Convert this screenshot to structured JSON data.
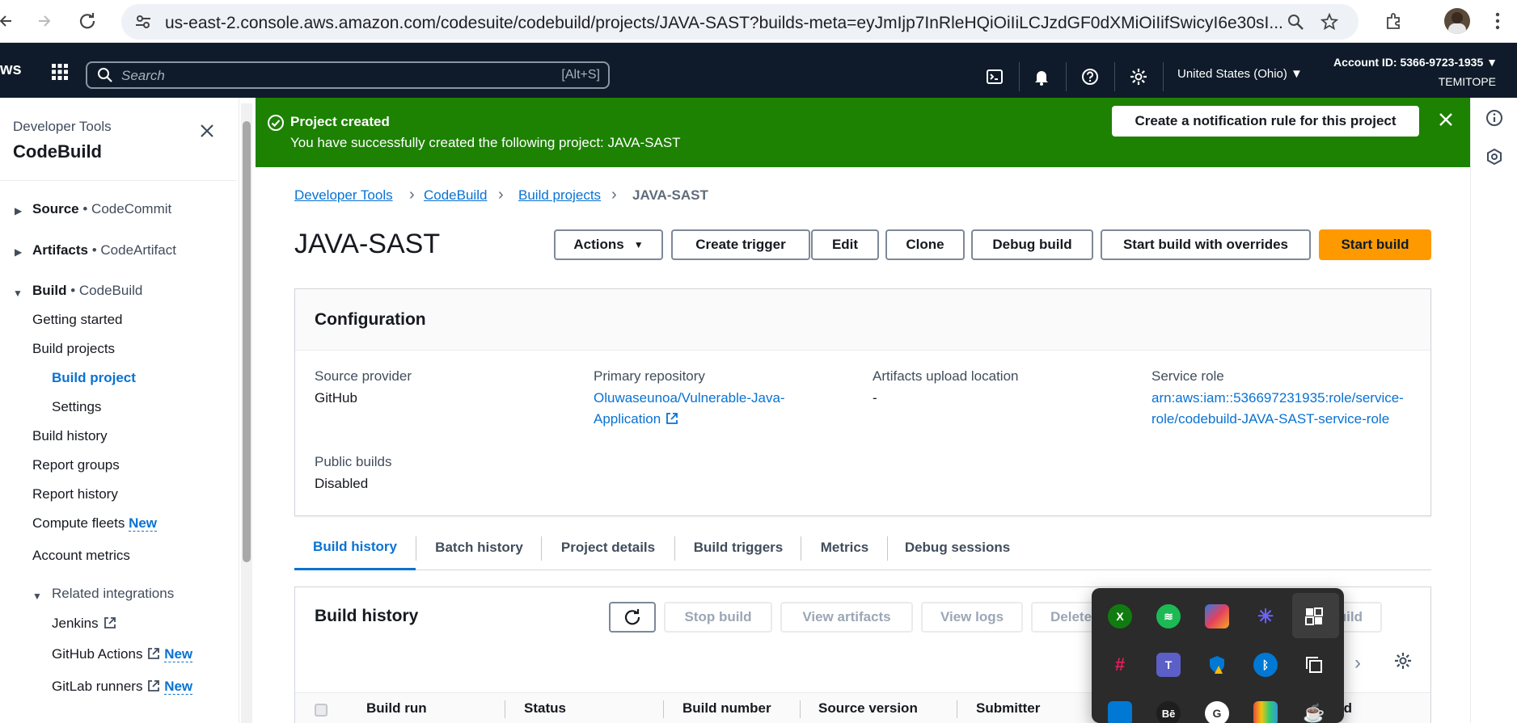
{
  "browser": {
    "url": "us-east-2.console.aws.amazon.com/codesuite/codebuild/projects/JAVA-SAST?builds-meta=eyJmIjp7InRleHQiOiIiLCJzdGF0dXMiOiIifSwicyI6e30sI..."
  },
  "aws_nav": {
    "logo": "ws",
    "search_placeholder": "Search",
    "search_shortcut": "[Alt+S]",
    "region": "United States (Ohio) ▼",
    "account_id": "Account ID: 5366-9723-1935 ▼",
    "user": "TEMITOPE"
  },
  "sidebar": {
    "service": "Developer Tools",
    "title": "CodeBuild",
    "sections": [
      {
        "name": "Source",
        "sub": "• CodeCommit"
      },
      {
        "name": "Artifacts",
        "sub": "• CodeArtifact"
      },
      {
        "name": "Build",
        "sub": "• CodeBuild"
      }
    ],
    "items": {
      "getting_started": "Getting started",
      "build_projects": "Build projects",
      "build_project": "Build project",
      "settings": "Settings",
      "build_history": "Build history",
      "report_groups": "Report groups",
      "report_history": "Report history",
      "compute_fleets": "Compute fleets",
      "account_metrics": "Account metrics",
      "related_integrations": "Related integrations",
      "jenkins": "Jenkins",
      "github_actions": "GitHub Actions",
      "gitlab_runners": "GitLab runners",
      "new_badge": "New"
    }
  },
  "flash": {
    "title": "Project created",
    "message": "You have successfully created the following project: JAVA-SAST",
    "button": "Create a notification rule for this project"
  },
  "breadcrumb": {
    "items": [
      "Developer Tools",
      "CodeBuild",
      "Build projects"
    ],
    "current": "JAVA-SAST"
  },
  "page": {
    "title": "JAVA-SAST",
    "buttons": {
      "actions": "Actions",
      "create_trigger": "Create trigger",
      "edit": "Edit",
      "clone": "Clone",
      "debug_build": "Debug build",
      "start_with_overrides": "Start build with overrides",
      "start_build": "Start build"
    }
  },
  "configuration": {
    "title": "Configuration",
    "source_provider_label": "Source provider",
    "source_provider": "GitHub",
    "primary_repo_label": "Primary repository",
    "primary_repo_line1": "Oluwaseunoa/Vulnerable-Java-",
    "primary_repo_line2": "Application",
    "artifacts_label": "Artifacts upload location",
    "artifacts_value": "-",
    "service_role_label": "Service role",
    "service_role_line1": "arn:aws:iam::536697231935:role/service-",
    "service_role_line2": "role/codebuild-JAVA-SAST-service-role",
    "public_builds_label": "Public builds",
    "public_builds": "Disabled"
  },
  "tabs": [
    "Build history",
    "Batch history",
    "Project details",
    "Build triggers",
    "Metrics",
    "Debug sessions"
  ],
  "build_history": {
    "title": "Build history",
    "buttons": {
      "stop": "Stop build",
      "view_artifacts": "View artifacts",
      "view_logs": "View logs",
      "delete": "Delete",
      "debug": "g build"
    },
    "columns": [
      "Build run",
      "Status",
      "Build number",
      "Source version",
      "Submitter",
      "ated"
    ]
  },
  "tray_popup": {
    "icons": [
      "xbox-icon",
      "spotify-icon",
      "copilot-icon",
      "perplexity-icon",
      "capcut-icon",
      "slack-icon",
      "teams-icon",
      "defender-icon",
      "bluetooth-icon",
      "copy-icon",
      "windows-store-icon",
      "beats-icon",
      "google-icon",
      "photos-icon",
      "cup-icon"
    ]
  },
  "colors": {
    "aws_nav_bg": "#0f1b2a",
    "flash_green": "#1d8102",
    "link_blue": "#0972d3",
    "primary_orange": "#ff9900"
  }
}
